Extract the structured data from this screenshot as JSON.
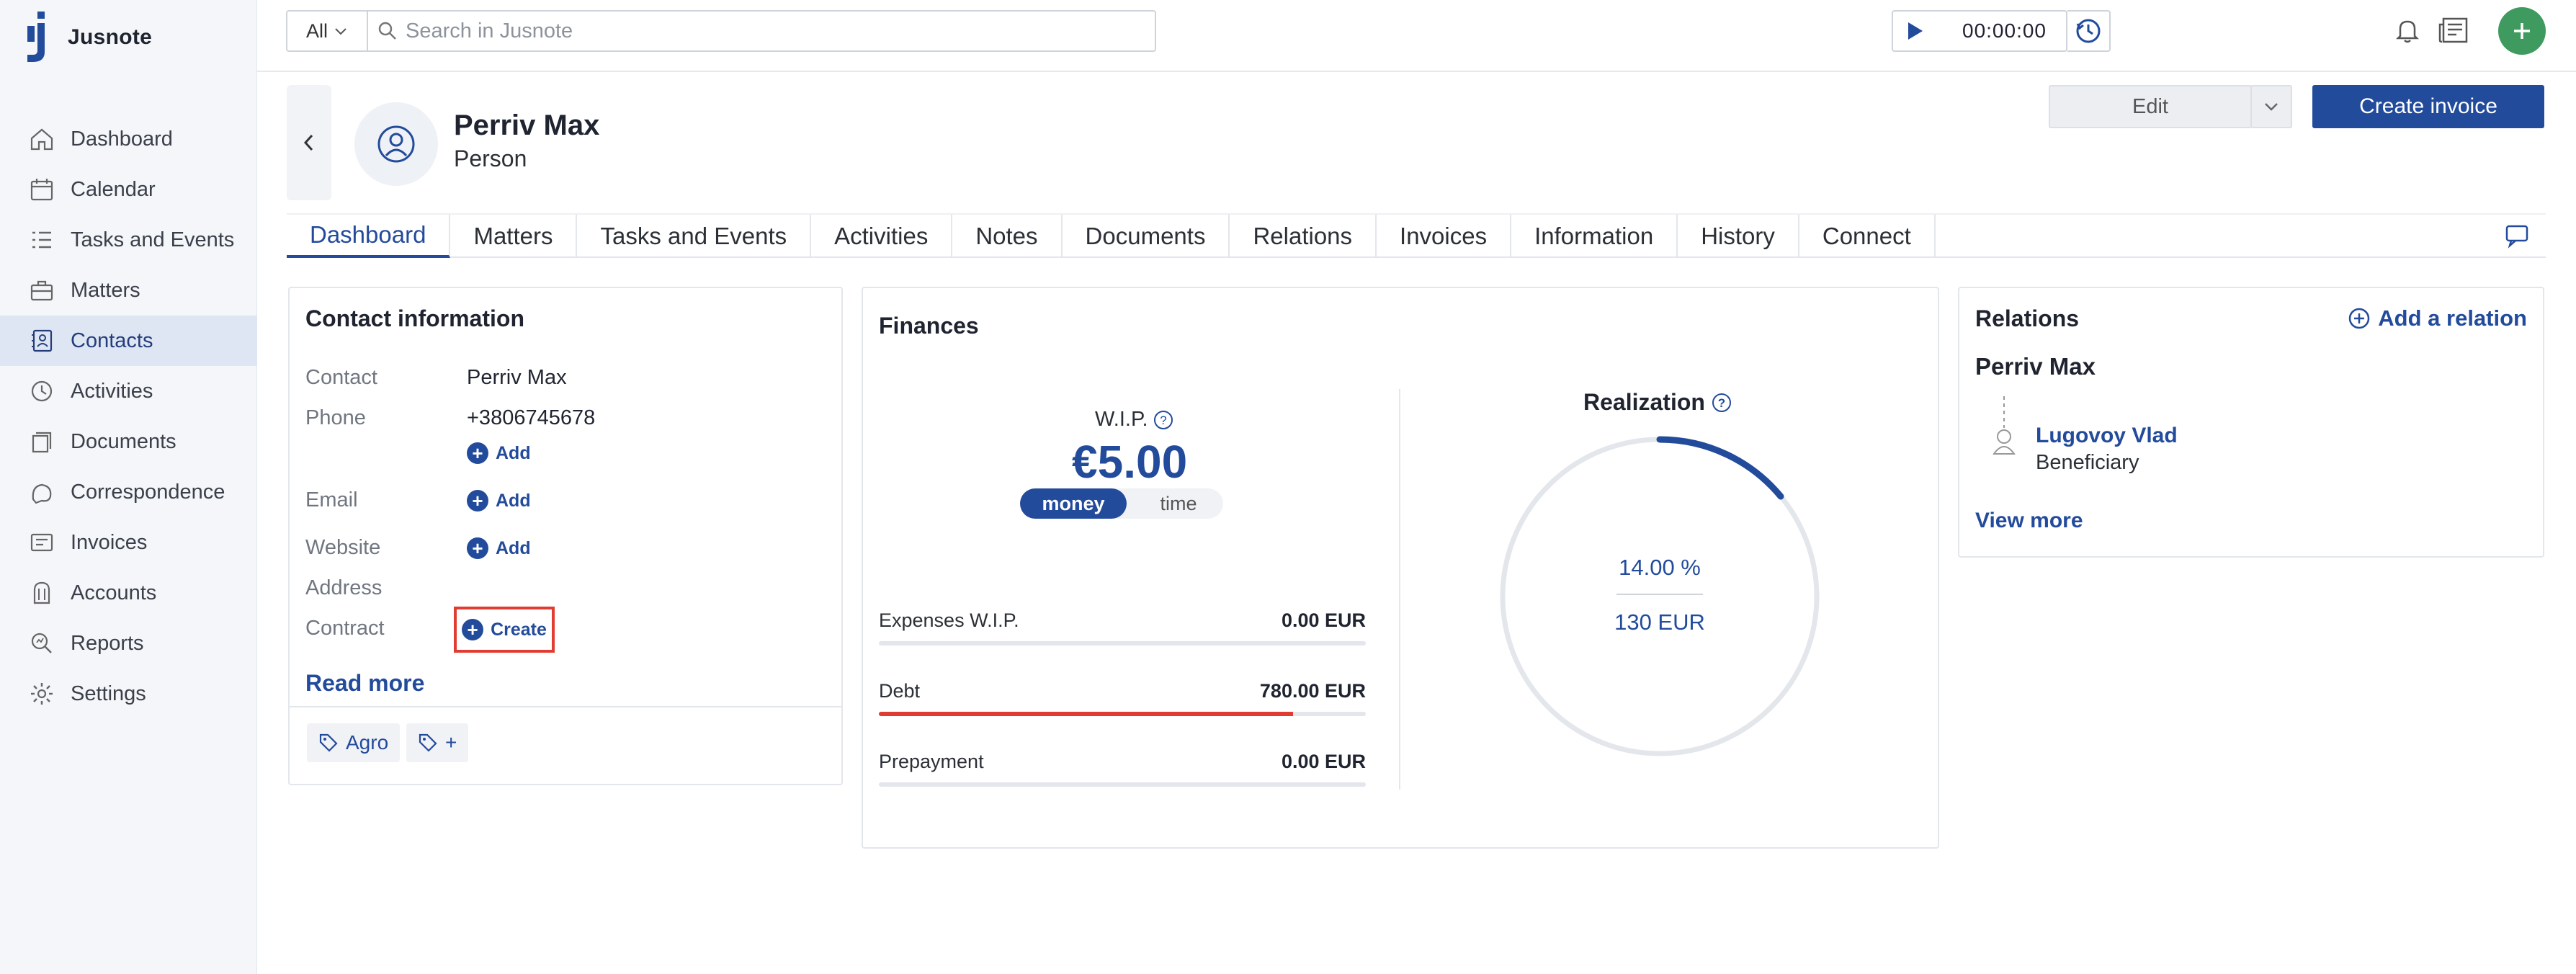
{
  "app": {
    "name": "Jusnote"
  },
  "sidebar": {
    "items": [
      {
        "label": "Dashboard",
        "icon": "home-icon"
      },
      {
        "label": "Calendar",
        "icon": "calendar-icon"
      },
      {
        "label": "Tasks and Events",
        "icon": "tasks-icon"
      },
      {
        "label": "Matters",
        "icon": "briefcase-icon"
      },
      {
        "label": "Contacts",
        "icon": "contacts-icon",
        "active": true
      },
      {
        "label": "Activities",
        "icon": "activities-icon"
      },
      {
        "label": "Documents",
        "icon": "documents-icon"
      },
      {
        "label": "Correspondence",
        "icon": "correspondence-icon"
      },
      {
        "label": "Invoices",
        "icon": "invoices-icon"
      },
      {
        "label": "Accounts",
        "icon": "accounts-icon"
      },
      {
        "label": "Reports",
        "icon": "reports-icon"
      },
      {
        "label": "Settings",
        "icon": "gear-icon"
      }
    ]
  },
  "search": {
    "scope": "All",
    "placeholder": "Search in Jusnote"
  },
  "timer": {
    "time": "00:00:00"
  },
  "header": {
    "name": "Perriv Max",
    "type": "Person",
    "edit_label": "Edit",
    "invoice_label": "Create invoice"
  },
  "tabs": [
    "Dashboard",
    "Matters",
    "Tasks and Events",
    "Activities",
    "Notes",
    "Documents",
    "Relations",
    "Invoices",
    "Information",
    "History",
    "Connect"
  ],
  "contact_info": {
    "title": "Contact information",
    "contact_label": "Contact",
    "contact_value": "Perriv Max",
    "phone_label": "Phone",
    "phone_value": "+3806745678",
    "phone_add": "Add",
    "email_label": "Email",
    "email_add": "Add",
    "website_label": "Website",
    "website_add": "Add",
    "address_label": "Address",
    "contract_label": "Contract",
    "contract_create": "Create",
    "read_more": "Read more",
    "tags": [
      "Agro",
      "+"
    ]
  },
  "finances": {
    "title": "Finances",
    "wip_label": "W.I.P.",
    "wip_value": "€5.00",
    "toggle_money": "money",
    "toggle_time": "time",
    "rows": [
      {
        "name": "Expenses W.I.P.",
        "amount": "0.00 EUR",
        "fill": 0
      },
      {
        "name": "Debt",
        "amount": "780.00 EUR",
        "fill": 0.85
      },
      {
        "name": "Prepayment",
        "amount": "0.00 EUR",
        "fill": 0
      }
    ],
    "realization_title": "Realization",
    "realization_percent": "14.00 %",
    "realization_value": 0.14,
    "realization_amount": "130 EUR",
    "colors": {
      "accent": "#234b9c",
      "debt": "#e03c31",
      "track": "#e3e6eb"
    }
  },
  "relations": {
    "title": "Relations",
    "add_label": "Add a relation",
    "root_name": "Perriv Max",
    "related_name": "Lugovoy Vlad",
    "related_role": "Beneficiary",
    "view_more": "View more"
  }
}
